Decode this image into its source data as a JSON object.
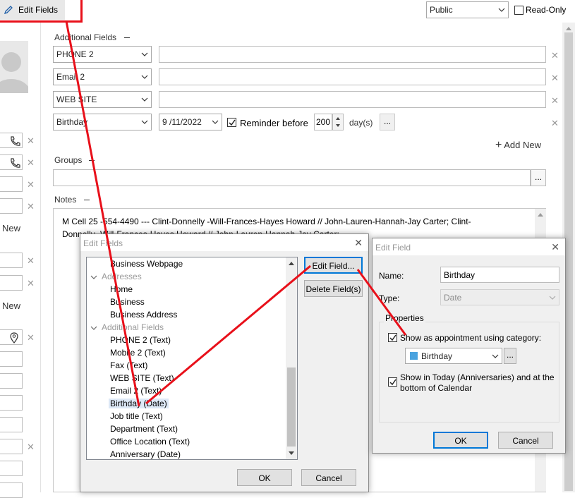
{
  "toolbar": {
    "edit_fields_label": "Edit Fields",
    "visibility_value": "Public",
    "readonly_label": "Read-Only",
    "readonly_checked": false
  },
  "additional_fields": {
    "section_label": "Additional Fields",
    "rows": [
      {
        "field": "PHONE 2",
        "value": ""
      },
      {
        "field": "Email 2",
        "value": ""
      },
      {
        "field": "WEB SITE",
        "value": ""
      }
    ],
    "birthday": {
      "field": "Birthday",
      "date": "9 /11/2022",
      "reminder_label": "Reminder before",
      "reminder_checked": true,
      "reminder_value": "200",
      "unit": "day(s)",
      "more": "..."
    },
    "add_new_label": "Add New"
  },
  "groups": {
    "section_label": "Groups",
    "value": "",
    "more": "..."
  },
  "notes": {
    "section_label": "Notes",
    "line1": "M Cell 25    -554-4490 --- Clint-Donnelly -Will-Frances-Hayes Howard // John-Lauren-Hannah-Jay Carter;  Clint-",
    "line2": "Donnelly -Will-Frances-Hayes Howard // John-Lauren-Hannah-Jay Carter;"
  },
  "left_panel": {
    "new_label_1": "New",
    "new_label_2": "New"
  },
  "edit_fields_dialog": {
    "title": "Edit Fields",
    "items": [
      {
        "label": "Business Webpage",
        "kind": "leaf"
      },
      {
        "label": "Addresses",
        "kind": "category"
      },
      {
        "label": "Home",
        "kind": "leaf"
      },
      {
        "label": "Business",
        "kind": "leaf"
      },
      {
        "label": "Business Address",
        "kind": "leaf"
      },
      {
        "label": "Additional Fields",
        "kind": "category"
      },
      {
        "label": "PHONE 2  (Text)",
        "kind": "leaf"
      },
      {
        "label": "Mobile 2  (Text)",
        "kind": "leaf"
      },
      {
        "label": "Fax  (Text)",
        "kind": "leaf"
      },
      {
        "label": "WEB SITE  (Text)",
        "kind": "leaf"
      },
      {
        "label": "Email 2  (Text)",
        "kind": "leaf"
      },
      {
        "label": "Birthday  (Date)",
        "kind": "leaf",
        "selected": true
      },
      {
        "label": "Job title  (Text)",
        "kind": "leaf"
      },
      {
        "label": "Department  (Text)",
        "kind": "leaf"
      },
      {
        "label": "Office Location  (Text)",
        "kind": "leaf"
      },
      {
        "label": "Anniversary  (Date)",
        "kind": "leaf"
      }
    ],
    "edit_field_button": "Edit Field...",
    "delete_field_button": "Delete Field(s)",
    "ok_button": "OK",
    "cancel_button": "Cancel"
  },
  "edit_field_dialog": {
    "title": "Edit Field",
    "name_label": "Name:",
    "name_value": "Birthday",
    "type_label": "Type:",
    "type_value": "Date",
    "properties_label": "Properties",
    "show_appointment_label": "Show as appointment using category:",
    "show_appointment_checked": true,
    "category_value": "Birthday",
    "category_color": "#4aa3df",
    "more": "...",
    "show_today_label_1": "Show in Today (Anniversaries) and at the",
    "show_today_label_2": "bottom of Calendar",
    "show_today_checked": true,
    "ok_button": "OK",
    "cancel_button": "Cancel"
  },
  "colors": {
    "annotation_red": "#e8101a",
    "focus_blue": "#0078d7",
    "selection": "#dde8f6"
  }
}
